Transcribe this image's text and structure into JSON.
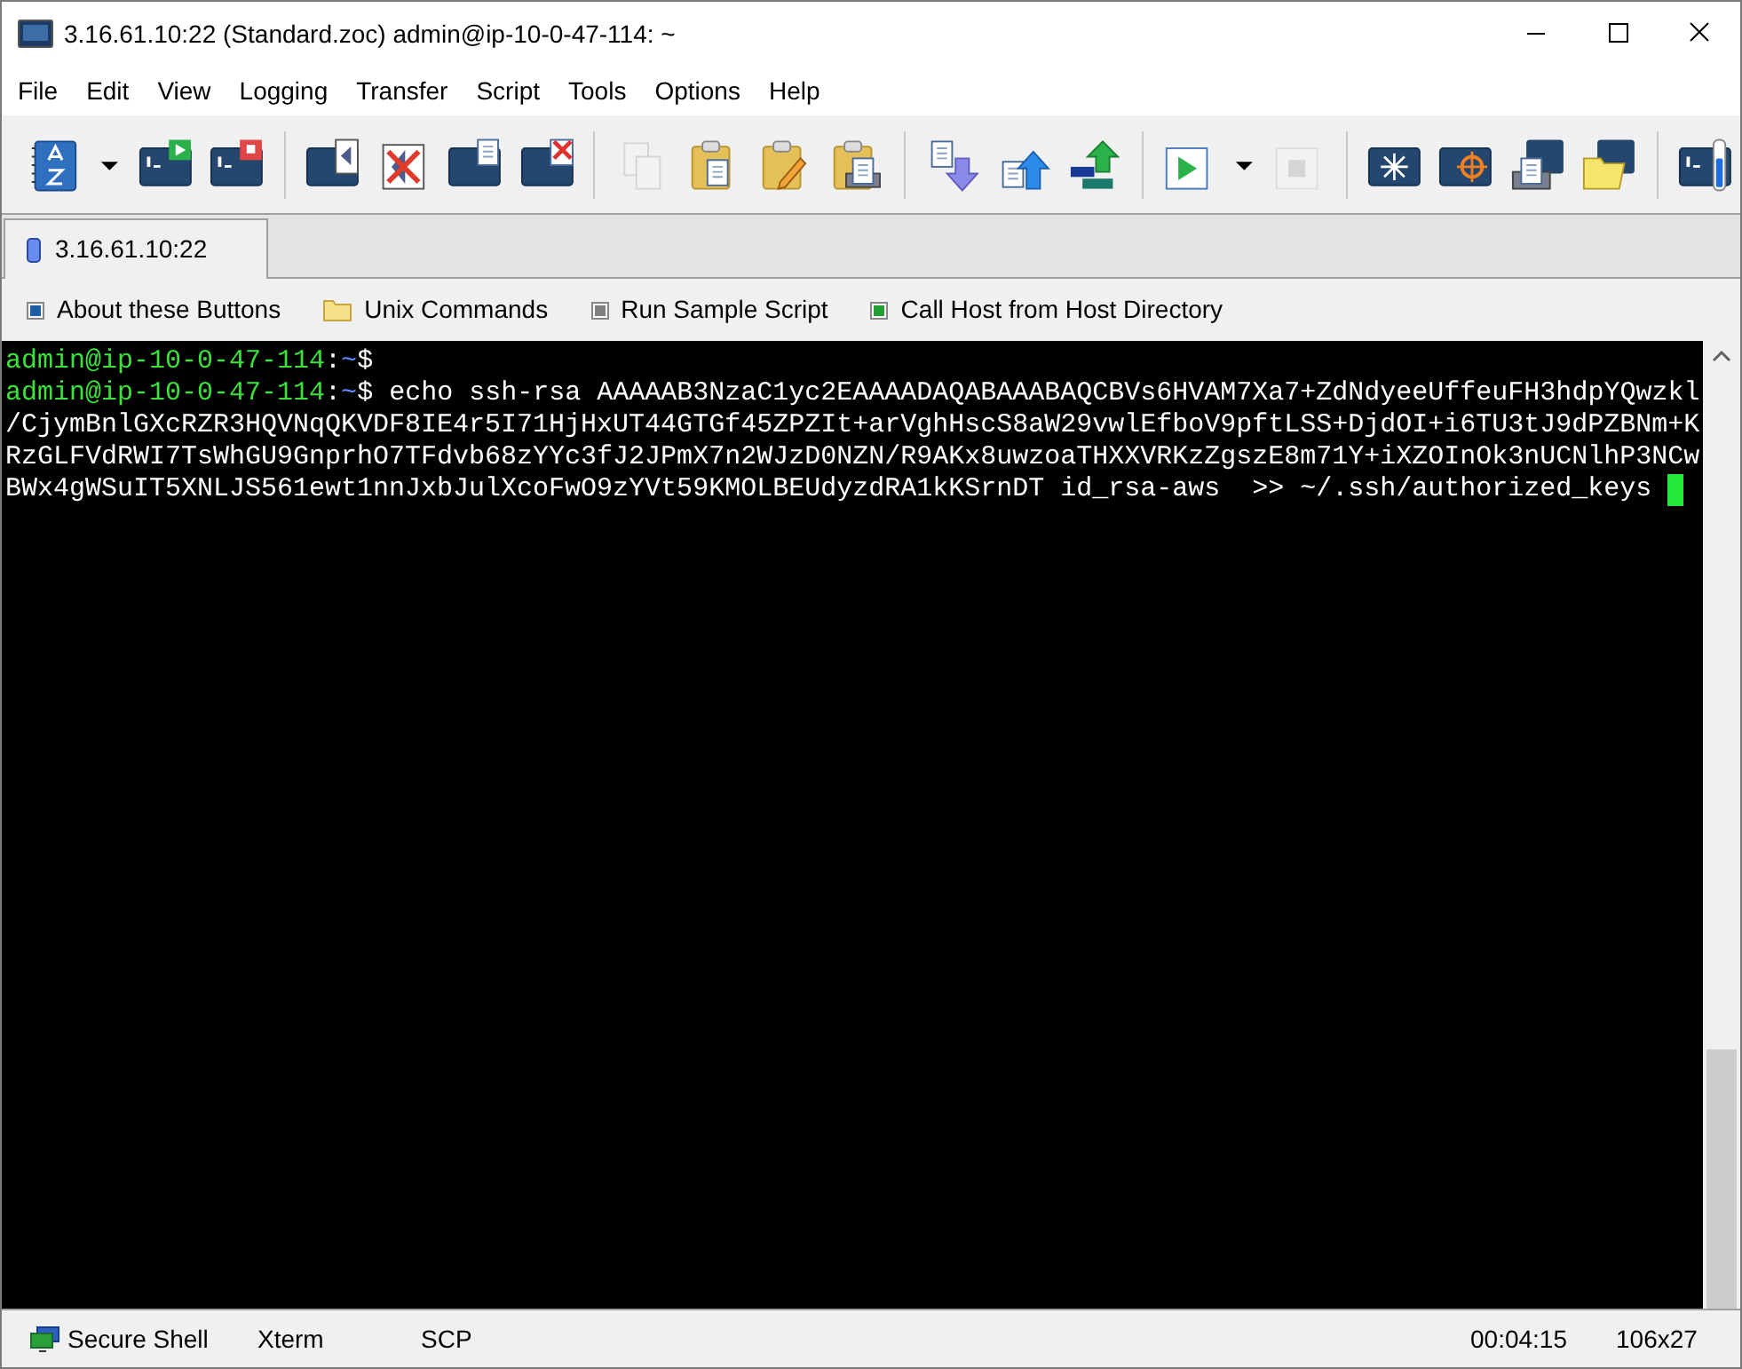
{
  "window": {
    "title": "3.16.61.10:22 (Standard.zoc) admin@ip-10-0-47-114: ~"
  },
  "menu": [
    "File",
    "Edit",
    "View",
    "Logging",
    "Transfer",
    "Script",
    "Tools",
    "Options",
    "Help"
  ],
  "toolbar": [
    [
      {
        "kind": "phonebook",
        "disabled": false
      },
      {
        "kind": "dropdown",
        "disabled": false
      },
      {
        "kind": "term-play",
        "disabled": false
      },
      {
        "kind": "term-stop",
        "disabled": false
      }
    ],
    [
      {
        "kind": "term-back",
        "disabled": false
      },
      {
        "kind": "doc-x",
        "disabled": false
      },
      {
        "kind": "term-doc",
        "disabled": false
      },
      {
        "kind": "term-doc-x",
        "disabled": false
      }
    ],
    [
      {
        "kind": "copy",
        "disabled": true
      },
      {
        "kind": "paste",
        "disabled": false
      },
      {
        "kind": "paste-edit",
        "disabled": false
      },
      {
        "kind": "paste-print",
        "disabled": false
      }
    ],
    [
      {
        "kind": "download",
        "disabled": false
      },
      {
        "kind": "upload",
        "disabled": false
      },
      {
        "kind": "translate",
        "disabled": false
      }
    ],
    [
      {
        "kind": "play",
        "disabled": false
      },
      {
        "kind": "dropdown",
        "disabled": false
      },
      {
        "kind": "stop",
        "disabled": true
      }
    ],
    [
      {
        "kind": "term-star",
        "disabled": false
      },
      {
        "kind": "term-target",
        "disabled": false
      },
      {
        "kind": "term-print",
        "disabled": false
      },
      {
        "kind": "term-folder",
        "disabled": false
      }
    ],
    [
      {
        "kind": "term-meter",
        "disabled": false
      }
    ]
  ],
  "tabs": [
    {
      "label": "3.16.61.10:22",
      "selected": true
    }
  ],
  "buttons": [
    {
      "label": "About these Buttons",
      "kind": "square",
      "color": "#1f5fa8"
    },
    {
      "label": "Unix Commands",
      "kind": "folder"
    },
    {
      "label": "Run Sample Script",
      "kind": "square",
      "color": "#808080"
    },
    {
      "label": "Call Host from Host Directory",
      "kind": "square",
      "color": "#22a033"
    }
  ],
  "terminal": {
    "lines": [
      {
        "kind": "prompt",
        "user_host": "admin@ip-10-0-47-114",
        "separator": ":",
        "path": "~",
        "symbol": "$"
      },
      {
        "kind": "prompt",
        "user_host": "admin@ip-10-0-47-114",
        "separator": ":",
        "path": "~",
        "symbol": "$",
        "text": " echo ssh-rsa AAAAAB3NzaC1yc2EAAAADAQABAAABAQCBVs6HVAM7Xa7+ZdNdyeeUffeuFH3hdpYQwzkl"
      },
      {
        "kind": "output",
        "text": "/CjymBnlGXcRZR3HQVNqQKVDF8IE4r5I71HjHxUT44GTGf45ZPZIt+arVghHscS8aW29vwlEfboV9pftLSS+DjdOI+i6TU3tJ9dPZBNm+K"
      },
      {
        "kind": "output",
        "text": "RzGLFVdRWI7TsWhGU9GnprhO7TFdvb68zYYc3fJ2JPmX7n2WJzD0NZN/R9AKx8uwzoaTHXXVRKzZgszE8m71Y+iXZOInOk3nUCNlhP3NCw"
      },
      {
        "kind": "output",
        "text": "BWx4gWSuIT5XNLJS561ewt1nnJxbJulXcoFwO9zYVt59KMOLBEUdyzdRA1kKSrnDT id_rsa-aws  >> ~/.ssh/authorized_keys",
        "cursor": true
      }
    ]
  },
  "status_bar": {
    "connection": "Secure Shell",
    "emulation": "Xterm",
    "transfer": "SCP",
    "elapsed": "00:04:15",
    "size": "106x27"
  }
}
